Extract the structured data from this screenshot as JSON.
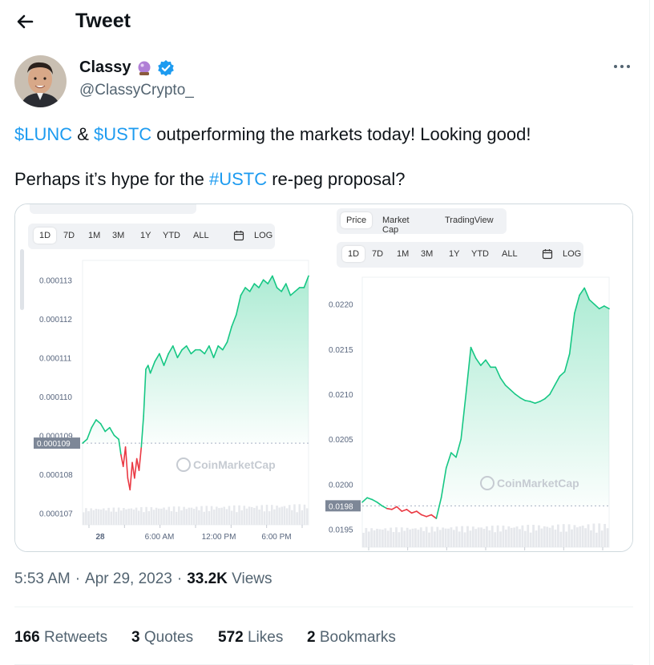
{
  "header": {
    "title": "Tweet"
  },
  "author": {
    "name": "Classy",
    "emoji": "🔮",
    "handle": "@ClassyCrypto_"
  },
  "tweet": {
    "line1": {
      "t1": "$LUNC",
      "t2": " & ",
      "t3": "$USTC",
      "t4": " outperforming the markets today! Looking good!"
    },
    "line2": {
      "t1": "Perhaps it’s hype for the ",
      "t2": "#USTC",
      "t3": " re-peg proposal?"
    }
  },
  "meta": {
    "time": "5:53 AM",
    "sep": "·",
    "date": "Apr 29, 2023",
    "sep2": "·",
    "views": "33.2K",
    "views_label": "Views"
  },
  "stats": {
    "retweets": "166",
    "retweets_label": "Retweets",
    "quotes": "3",
    "quotes_label": "Quotes",
    "likes": "572",
    "likes_label": "Likes",
    "bookmarks": "2",
    "bookmarks_label": "Bookmarks"
  },
  "colors": {
    "link": "#1d9bf0",
    "verified": "#1d9bf0",
    "up": "#16c784",
    "down": "#ea3943"
  },
  "icons": {
    "back": "arrow-left-icon",
    "verified": "verified-badge-icon",
    "more": "more-horizontal-icon",
    "calendar": "calendar-icon"
  },
  "chart_data": [
    {
      "type": "line",
      "title": "",
      "ranges": [
        "1D",
        "7D",
        "1M",
        "3M",
        "1Y",
        "YTD",
        "ALL",
        "LOG"
      ],
      "active_range": "1D",
      "yticks": [
        "0.000113",
        "0.000112",
        "0.000111",
        "0.000110",
        "0.000109",
        "0.000108",
        "0.000107"
      ],
      "ylim": [
        0.0001067,
        0.0001135
      ],
      "xticks": [
        "28",
        "6:00 AM",
        "12:00 PM",
        "6:00 PM"
      ],
      "baseline_label": "0.000109",
      "baseline": 0.0001088,
      "watermark": "CoinMarketCap",
      "series": [
        {
          "x": [
            0,
            2,
            4,
            6,
            8,
            10,
            12,
            14,
            16,
            17,
            18,
            19,
            20,
            21,
            22,
            23,
            24,
            25,
            26,
            27,
            28,
            29,
            30,
            32,
            34,
            36,
            38,
            40,
            42,
            44,
            46,
            48,
            50,
            52,
            54,
            56,
            58,
            60,
            62,
            64,
            66,
            68,
            70,
            72,
            74,
            76,
            78,
            80,
            82,
            84,
            86,
            88,
            90,
            92,
            94,
            96,
            98,
            100
          ],
          "y": [
            0.0001088,
            0.0001089,
            0.0001092,
            0.0001094,
            0.0001093,
            0.0001091,
            0.0001092,
            0.000109,
            0.0001089,
            0.0001085,
            0.0001082,
            0.0001087,
            0.0001079,
            0.0001076,
            0.0001083,
            0.0001079,
            0.0001084,
            0.0001081,
            0.0001087,
            0.0001095,
            0.0001107,
            0.0001108,
            0.0001106,
            0.0001109,
            0.0001111,
            0.0001108,
            0.0001111,
            0.0001113,
            0.000111,
            0.0001112,
            0.0001113,
            0.0001111,
            0.0001112,
            0.0001112,
            0.0001111,
            0.0001113,
            0.000111,
            0.0001113,
            0.0001112,
            0.0001114,
            0.0001118,
            0.0001121,
            0.0001126,
            0.0001128,
            0.0001127,
            0.0001129,
            0.0001128,
            0.000113,
            0.0001129,
            0.0001131,
            0.0001128,
            0.0001127,
            0.0001129,
            0.0001126,
            0.0001127,
            0.0001128,
            0.0001128,
            0.0001131
          ]
        }
      ]
    },
    {
      "type": "line",
      "title": "",
      "tabs": [
        "Price",
        "Market Cap",
        "TradingView"
      ],
      "active_tab": "Price",
      "ranges": [
        "1D",
        "7D",
        "1M",
        "3M",
        "1Y",
        "YTD",
        "ALL",
        "LOG"
      ],
      "active_range": "1D",
      "yticks": [
        "0.0220",
        "0.0215",
        "0.0210",
        "0.0205",
        "0.0200",
        "0.0195"
      ],
      "ylim": [
        0.0193,
        0.0223
      ],
      "baseline_label": "0.0198",
      "baseline": 0.01976,
      "watermark": "CoinMarketCap",
      "series": [
        {
          "x": [
            0,
            2,
            4,
            6,
            8,
            10,
            12,
            14,
            16,
            18,
            20,
            22,
            24,
            26,
            28,
            30,
            32,
            34,
            36,
            38,
            40,
            42,
            44,
            46,
            48,
            50,
            52,
            54,
            56,
            58,
            60,
            62,
            64,
            66,
            68,
            70,
            72,
            74,
            76,
            78,
            80,
            82,
            84,
            86,
            88,
            90,
            92,
            94,
            96,
            98,
            100
          ],
          "y": [
            0.0198,
            0.01985,
            0.01983,
            0.0198,
            0.01976,
            0.01973,
            0.01972,
            0.01975,
            0.0197,
            0.01972,
            0.01968,
            0.0197,
            0.01966,
            0.01964,
            0.01966,
            0.01962,
            0.01985,
            0.02018,
            0.02035,
            0.0203,
            0.0205,
            0.021,
            0.02152,
            0.0214,
            0.02132,
            0.02138,
            0.0213,
            0.0213,
            0.02118,
            0.0211,
            0.02105,
            0.021,
            0.02096,
            0.02093,
            0.02092,
            0.0209,
            0.02092,
            0.02095,
            0.021,
            0.0211,
            0.0212,
            0.02125,
            0.02145,
            0.0219,
            0.0221,
            0.02218,
            0.02205,
            0.022,
            0.02195,
            0.02198,
            0.02195
          ]
        }
      ]
    }
  ]
}
